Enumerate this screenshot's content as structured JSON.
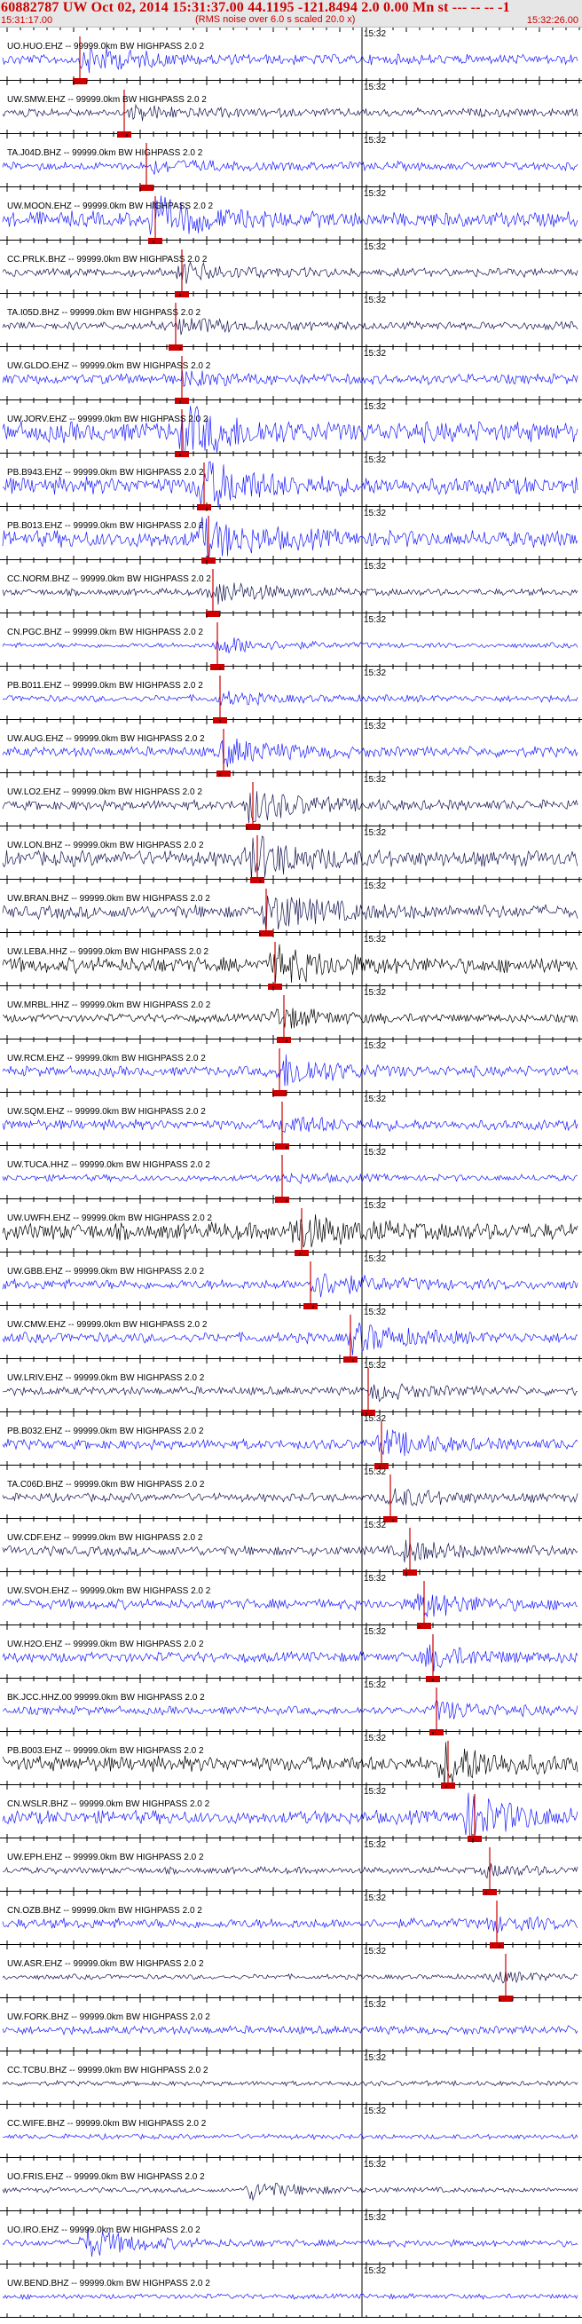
{
  "header": {
    "title": "60882787 UW Oct 02, 2014 15:31:37.00   44.1195 -121.8494  2.0 0.00 Mn st --- -- --  -1",
    "start_time": "15:31:17.00",
    "rms_note": "(RMS noise over 6.0 s scaled 20.0 x)",
    "end_time": "15:32:26.00"
  },
  "time_tick_label": "15:32",
  "colors": {
    "header_text": "#cc0000",
    "header_bg": "#e6e6e6",
    "pick_marker": "#cc0000",
    "trace_blue": "#1a1aff",
    "trace_navy": "#141450",
    "trace_black": "#000000"
  },
  "traces": [
    {
      "label": "UO.HUO.EHZ -- 99999.0km BW  HIGHPASS  2.0  2"
    },
    {
      "label": "UW.SMW.EHZ -- 99999.0km BW  HIGHPASS  2.0  2"
    },
    {
      "label": "TA.J04D.BHZ -- 99999.0km BW  HIGHPASS  2.0  2"
    },
    {
      "label": "UW.MOON.EHZ -- 99999.0km BW  HIGHPASS  2.0  2"
    },
    {
      "label": "CC.PRLK.BHZ -- 99999.0km BW  HIGHPASS  2.0  2"
    },
    {
      "label": "TA.I05D.BHZ -- 99999.0km BW  HIGHPASS  2.0  2"
    },
    {
      "label": "UW.GLDO.EHZ -- 99999.0km BW  HIGHPASS  2.0  2"
    },
    {
      "label": "UW.JORV.EHZ -- 99999.0km BW  HIGHPASS  2.0  2"
    },
    {
      "label": "PB.B943.EHZ -- 99999.0km BW  HIGHPASS  2.0  2"
    },
    {
      "label": "PB.B013.EHZ -- 99999.0km BW  HIGHPASS  2.0  2"
    },
    {
      "label": "CC.NORM.BHZ -- 99999.0km BW  HIGHPASS  2.0  2"
    },
    {
      "label": "CN.PGC.BHZ -- 99999.0km BW  HIGHPASS  2.0  2"
    },
    {
      "label": "PB.B011.EHZ -- 99999.0km BW  HIGHPASS  2.0  2"
    },
    {
      "label": "UW.AUG.EHZ -- 99999.0km BW  HIGHPASS  2.0  2"
    },
    {
      "label": "UW.LO2.EHZ -- 99999.0km BW  HIGHPASS  2.0  2"
    },
    {
      "label": "UW.LON.BHZ -- 99999.0km BW  HIGHPASS  2.0  2"
    },
    {
      "label": "UW.BRAN.BHZ -- 99999.0km BW  HIGHPASS  2.0  2"
    },
    {
      "label": "UW.LEBA.HHZ -- 99999.0km BW  HIGHPASS  2.0  2"
    },
    {
      "label": "UW.MRBL.HHZ -- 99999.0km BW  HIGHPASS  2.0  2"
    },
    {
      "label": "UW.RCM.EHZ -- 99999.0km BW  HIGHPASS  2.0  2"
    },
    {
      "label": "UW.SQM.EHZ -- 99999.0km BW  HIGHPASS  2.0  2"
    },
    {
      "label": "UW.TUCA.HHZ -- 99999.0km BW  HIGHPASS  2.0  2"
    },
    {
      "label": "UW.UWFH.EHZ -- 99999.0km BW  HIGHPASS  2.0  2"
    },
    {
      "label": "UW.GBB.EHZ -- 99999.0km BW  HIGHPASS  2.0  2"
    },
    {
      "label": "UW.CMW.EHZ -- 99999.0km BW  HIGHPASS  2.0  2"
    },
    {
      "label": "UW.LRIV.EHZ -- 99999.0km BW  HIGHPASS  2.0  2"
    },
    {
      "label": "PB.B032.EHZ -- 99999.0km BW  HIGHPASS  2.0  2"
    },
    {
      "label": "TA.C06D.BHZ -- 99999.0km BW  HIGHPASS  2.0  2"
    },
    {
      "label": "UW.CDF.EHZ -- 99999.0km BW  HIGHPASS  2.0  2"
    },
    {
      "label": "UW.SVOH.EHZ -- 99999.0km BW  HIGHPASS  2.0  2"
    },
    {
      "label": "UW.H2O.EHZ -- 99999.0km BW  HIGHPASS  2.0  2"
    },
    {
      "label": "BK.JCC.HHZ.00 99999.0km BW  HIGHPASS  2.0  2"
    },
    {
      "label": "PB.B003.EHZ -- 99999.0km BW  HIGHPASS  2.0  2"
    },
    {
      "label": "CN.WSLR.BHZ -- 99999.0km BW  HIGHPASS  2.0  2"
    },
    {
      "label": "UW.EPH.EHZ -- 99999.0km BW  HIGHPASS  2.0  2"
    },
    {
      "label": "CN.OZB.BHZ -- 99999.0km BW  HIGHPASS  2.0  2"
    },
    {
      "label": "UW.ASR.EHZ -- 99999.0km BW  HIGHPASS  2.0  2"
    },
    {
      "label": "UW.FORK.BHZ -- 99999.0km BW  HIGHPASS  2.0  2"
    },
    {
      "label": "CC.TCBU.BHZ -- 99999.0km BW  HIGHPASS  2.0  2"
    },
    {
      "label": "CC.WIFE.BHZ -- 99999.0km BW  HIGHPASS  2.0  2"
    },
    {
      "label": "UO.FRIS.EHZ -- 99999.0km BW  HIGHPASS  2.0  2"
    },
    {
      "label": "UO.IRO.EHZ -- 99999.0km BW  HIGHPASS  2.0  2"
    },
    {
      "label": "UW.BEND.BHZ -- 99999.0km BW  HIGHPASS  2.0  2"
    }
  ]
}
